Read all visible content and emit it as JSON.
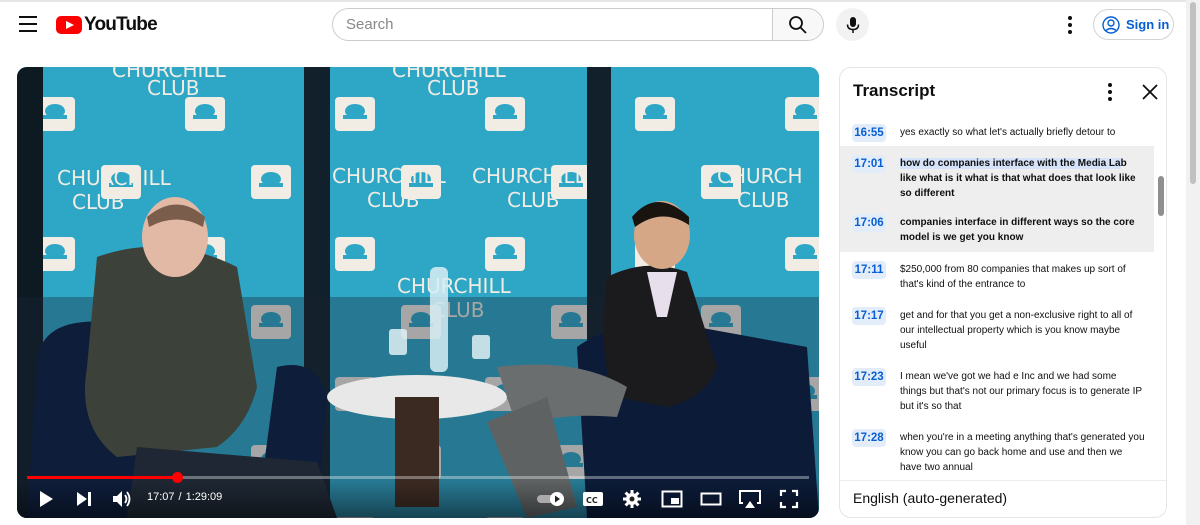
{
  "header": {
    "logo_text": "YouTube",
    "search_placeholder": "Search",
    "signin_label": "Sign in"
  },
  "player": {
    "current_time": "17:07",
    "separator": "/",
    "duration": "1:29:09",
    "progress_fraction": 0.192,
    "backdrop_signs": [
      "CHURCHILL",
      "CLUB"
    ]
  },
  "transcript": {
    "title": "Transcript",
    "language": "English (auto-generated)",
    "segments": [
      {
        "time": "16:55",
        "text": "yes exactly so what let's actually briefly detour to"
      },
      {
        "time": "17:01",
        "highlight": "how do companies interface with the Media La",
        "text": "b like what is it what is that what does that look like so different"
      },
      {
        "time": "17:06",
        "text": "companies interface in different ways so the core model is we get you know"
      },
      {
        "time": "17:11",
        "text": "$250,000 from 80 companies that makes up sort of that's kind of the entrance to"
      },
      {
        "time": "17:17",
        "text": "get and for that you get a non-exclusive right to all of our intellectual property which is you know maybe useful"
      },
      {
        "time": "17:23",
        "text": "I mean we've got we had e Inc and we had some things but that's not our primary focus is to generate IP but it's so that"
      },
      {
        "time": "17:28",
        "text": "when you're in a meeting anything that's generated you know you can go back home and use and then we have two annual"
      }
    ]
  }
}
